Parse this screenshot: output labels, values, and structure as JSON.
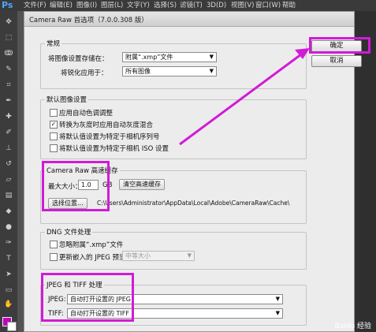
{
  "menubar": {
    "logo": "Ps",
    "items": [
      "文件(F)",
      "编辑(E)",
      "图像(I)",
      "图层(L)",
      "文字(Y)",
      "选择(S)",
      "滤镜(T)",
      "3D(D)",
      "视图(V)",
      "窗口(W)",
      "帮助"
    ]
  },
  "dialog": {
    "title": "Camera Raw 首选项（7.0.0.308 版）",
    "ok_label": "确定",
    "cancel_label": "取消",
    "general": {
      "title": "常规",
      "save_settings_label": "将图像设置存储在：",
      "save_settings_value": "附属“.xmp”文件",
      "sharpen_label": "将锐化应用于：",
      "sharpen_value": "所有图像"
    },
    "defaults": {
      "title": "默认图像设置",
      "options": [
        {
          "label": "应用自动色调调整",
          "checked": false
        },
        {
          "label": "转换为灰度时应用自动灰度混合",
          "checked": true
        },
        {
          "label": "将默认值设置为特定于相机序列号",
          "checked": false
        },
        {
          "label": "将默认值设置为特定于相机 ISO 设置",
          "checked": false
        }
      ]
    },
    "cache": {
      "title": "Camera Raw 高速缓存",
      "max_size_label": "最大大小：",
      "max_size_value": "1.0",
      "unit": "GB",
      "purge_label": "清空高速缓存",
      "select_location_label": "选择位置...",
      "path": "C:\\Users\\Administrator\\AppData\\Local\\Adobe\\CameraRaw\\Cache\\"
    },
    "dng": {
      "title": "DNG 文件处理",
      "ignore_xmp_label": "忽略附属“.xmp”文件",
      "update_jpeg_label": "更新嵌入的 JPEG 预览：",
      "preview_size_value": "中等大小"
    },
    "jpeg_tiff": {
      "title": "JPEG 和 TIFF 处理",
      "jpeg_label": "JPEG:",
      "jpeg_value": "自动打开设置的 JPEG",
      "tiff_label": "TIFF:",
      "tiff_value": "自动打开设置的 TIFF"
    }
  },
  "watermark": "Baidu 经验",
  "colors": {
    "highlight": "#d11bd6",
    "foreground_swatch": "#c000c0"
  }
}
